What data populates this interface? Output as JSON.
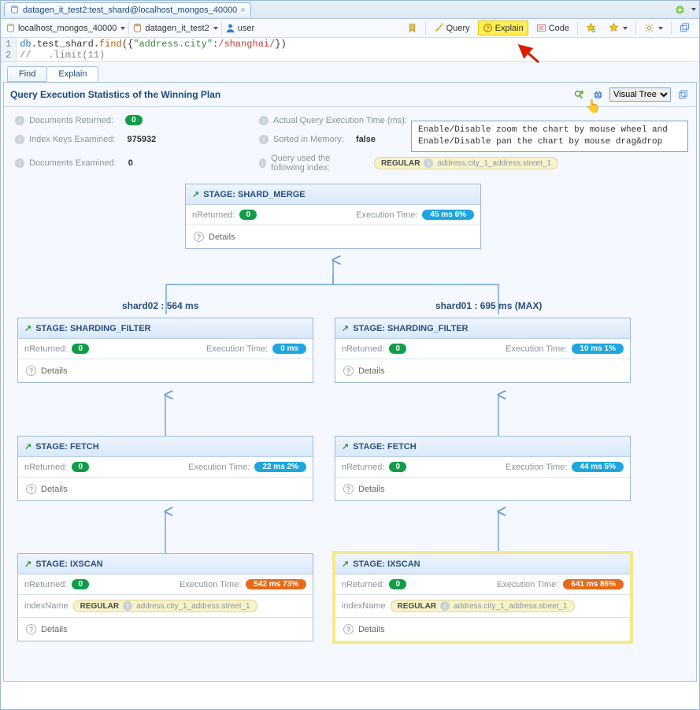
{
  "tabbar": {
    "tab_label": "datagen_it_test2:test_shard@localhost_mongos_40000"
  },
  "toolbar": {
    "conn": "localhost_mongos_40000",
    "db": "datagen_it_test2",
    "user": "user",
    "query_btn": "Query",
    "explain_btn": "Explain",
    "code_btn": "Code"
  },
  "editor": {
    "line1": {
      "n": "1",
      "id": "db",
      "obj": ".test_shard.",
      "fn": "find",
      "open": "({",
      "key": "\"address.city\"",
      "colon": ":",
      "re": "/shanghai/",
      "close": "})"
    },
    "line2": {
      "n": "2",
      "text": "//   .limit(11)"
    }
  },
  "subtabs": {
    "find": "Find",
    "explain": "Explain"
  },
  "panel": {
    "title": "Query Execution Statistics of the Winning Plan",
    "visual_sel": "Visual Tree"
  },
  "tooltip": {
    "l1": "Enable/Disable zoom the chart by mouse wheel and",
    "l2": "Enable/Disable pan the chart by mouse drag&drop"
  },
  "stats": {
    "docs_ret_label": "Documents Returned:",
    "docs_ret_val": "0",
    "aqet_label": "Actual Query Execution Time (ms):",
    "idx_label": "Index Keys Examined:",
    "idx_val": "975932",
    "sorted_label": "Sorted in Memory:",
    "sorted_val": "false",
    "docs_exam_label": "Documents Examined:",
    "docs_exam_val": "0",
    "query_idx_label": "Query used the following index:",
    "index_type": "REGULAR",
    "index_name": "address.city_1_address.street_1"
  },
  "tree": {
    "shard_labels": {
      "left": "shard02 : 564 ms",
      "right": "shard01 : 695 ms (MAX)"
    },
    "nreturned_label": "nReturned:",
    "exectime_label": "Execution Time:",
    "details_label": "Details",
    "indexname_label": "indexName",
    "nodes": {
      "root": {
        "title": "STAGE: SHARD_MERGE",
        "nret": "0",
        "exec": "45 ms  6%"
      },
      "sf_l": {
        "title": "STAGE: SHARDING_FILTER",
        "nret": "0",
        "exec": "0 ms"
      },
      "sf_r": {
        "title": "STAGE: SHARDING_FILTER",
        "nret": "0",
        "exec": "10 ms  1%"
      },
      "fetch_l": {
        "title": "STAGE: FETCH",
        "nret": "0",
        "exec": "22 ms  2%"
      },
      "fetch_r": {
        "title": "STAGE: FETCH",
        "nret": "0",
        "exec": "44 ms  5%"
      },
      "ix_l": {
        "title": "STAGE: IXSCAN",
        "nret": "0",
        "exec": "542 ms  73%",
        "idx_type": "REGULAR",
        "idx_name": "address.city_1_address.street_1"
      },
      "ix_r": {
        "title": "STAGE: IXSCAN",
        "nret": "0",
        "exec": "641 ms  86%",
        "idx_type": "REGULAR",
        "idx_name": "address.city_1_address.street_1"
      }
    }
  }
}
